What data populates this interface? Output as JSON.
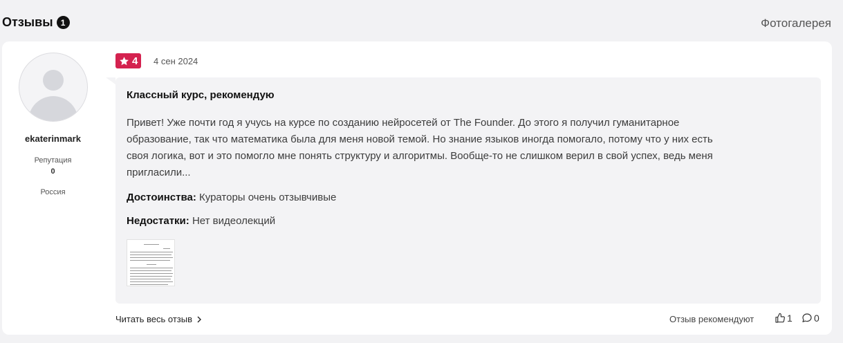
{
  "header": {
    "title": "Отзывы",
    "count": "1",
    "gallery_link": "Фотогалерея"
  },
  "review": {
    "author": {
      "name": "ekaterinmark",
      "reputation_label": "Репутация",
      "reputation_value": "0",
      "country": "Россия"
    },
    "rating": "4",
    "date": "4 сен 2024",
    "title": "Классный курс, рекомендую",
    "text_lines": [
      "Привет! Уже почти год я учусь на курсе по созданию нейросетей от The Founder. До этого я получил гуманитарное",
      "образование, так что математика была для меня новой темой. Но знание языков иногда помогало, потому что у них есть",
      "своя логика, вот и это помогло мне понять структуру и алгоритмы. Вообще-то не слишком верил в свой успех, ведь меня",
      "пригласили..."
    ],
    "pros_label": "Достоинства:",
    "pros": "Кураторы очень отзывчивые",
    "cons_label": "Недостатки:",
    "cons": "Нет видеолекций",
    "read_more": "Читать весь отзыв",
    "recommend_label": "Отзыв рекомендуют",
    "likes": "1",
    "comments": "0"
  },
  "colors": {
    "accent": "#d4224f",
    "page_bg": "#f2f2f4",
    "review_bg": "#f3f3f5"
  },
  "icons": [
    "star-icon",
    "chevron-right-icon",
    "thumbs-up-icon",
    "comment-icon",
    "avatar-placeholder-icon"
  ]
}
